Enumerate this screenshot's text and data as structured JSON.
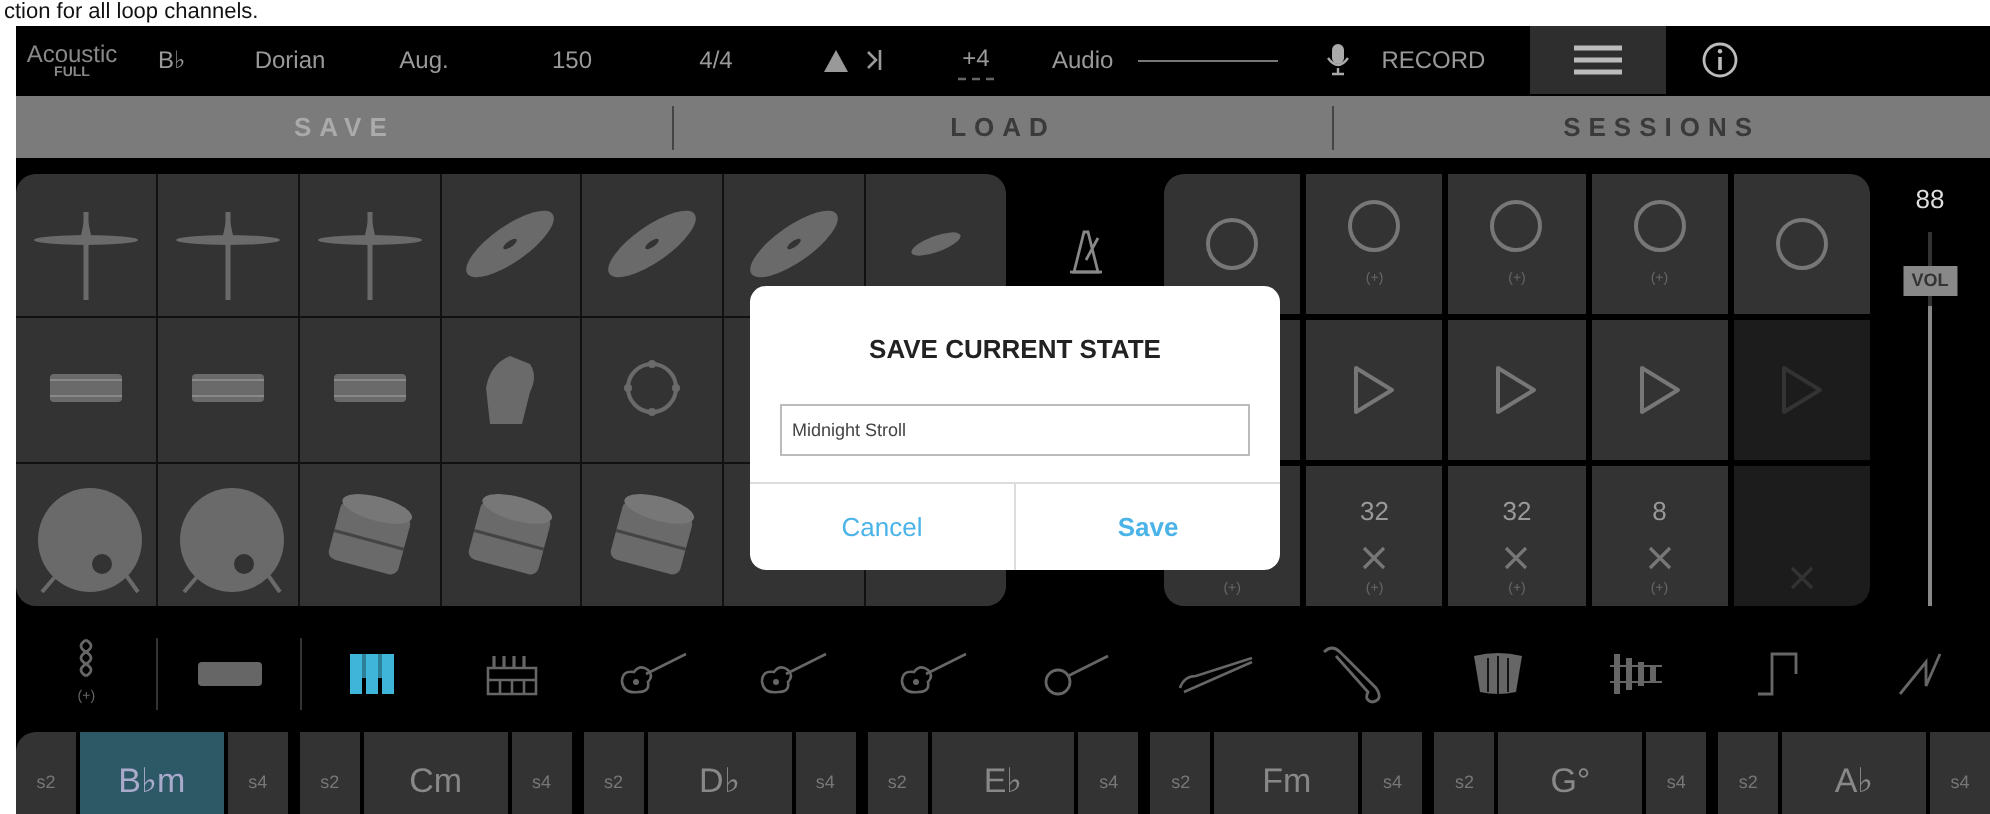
{
  "page_caption": "ction for all loop channels.",
  "top_bar": {
    "logo": "Acoustic",
    "logo_sub": "FULL",
    "key": "B♭",
    "mode": "Dorian",
    "chord_type": "Aug.",
    "tempo": "150",
    "time_signature": "4/4",
    "transpose": "+4",
    "audio": "Audio",
    "record": "RECORD"
  },
  "tabs": [
    {
      "label": "SAVE",
      "selected": true
    },
    {
      "label": "LOAD",
      "selected": false
    },
    {
      "label": "SESSIONS",
      "selected": false
    }
  ],
  "drum_pads": [
    [
      {
        "kind": "cymbal-stand"
      },
      {
        "kind": "cymbal-stand"
      },
      {
        "kind": "cymbal-stand"
      },
      {
        "kind": "cymbal"
      },
      {
        "kind": "cymbal"
      },
      {
        "kind": "cymbal"
      },
      {
        "kind": "splash"
      }
    ],
    [
      {
        "kind": "snare"
      },
      {
        "kind": "snare"
      },
      {
        "kind": "snare"
      },
      {
        "kind": "clap"
      },
      {
        "kind": "tambourine"
      }
    ],
    [
      {
        "kind": "kick"
      },
      {
        "kind": "kick"
      },
      {
        "kind": "tom"
      },
      {
        "kind": "tom"
      },
      {
        "kind": "tom"
      }
    ]
  ],
  "loops": [
    {
      "clear_hint": "(+)",
      "enabled": true,
      "covered": true
    },
    {
      "record_hint": "(+)",
      "length": "32",
      "clear_hint": "(+)",
      "enabled": true,
      "covered": false
    },
    {
      "record_hint": "(+)",
      "length": "32",
      "clear_hint": "(+)",
      "enabled": true,
      "covered": false
    },
    {
      "record_hint": "(+)",
      "length": "8",
      "clear_hint": "(+)",
      "enabled": true,
      "covered": false
    },
    {
      "enabled": false,
      "covered": false
    }
  ],
  "volume": {
    "value": "88",
    "label": "VOL",
    "level": 0.8
  },
  "dialog": {
    "title": "SAVE CURRENT STATE",
    "value": "Midnight Stroll",
    "buttons": [
      "Cancel",
      "Save"
    ]
  },
  "instruments": [
    {
      "kind": "chain",
      "hint": "(+)",
      "selected": false
    },
    {
      "kind": "bar",
      "selected": false
    },
    {
      "kind": "keys",
      "selected": true
    },
    {
      "kind": "organ",
      "selected": false
    },
    {
      "kind": "guitar",
      "selected": false
    },
    {
      "kind": "guitar",
      "selected": false
    },
    {
      "kind": "guitar",
      "selected": false
    },
    {
      "kind": "banjo",
      "selected": false
    },
    {
      "kind": "horn",
      "selected": false
    },
    {
      "kind": "saxophone",
      "selected": false
    },
    {
      "kind": "accordion",
      "selected": false
    },
    {
      "kind": "xylophone",
      "selected": false
    },
    {
      "kind": "square-wave",
      "selected": false
    },
    {
      "kind": "sawtooth-wave",
      "selected": false
    }
  ],
  "chords": [
    {
      "left": "s2",
      "chord": "B♭m",
      "right": "s4",
      "selected": true
    },
    {
      "left": "s2",
      "chord": "Cm",
      "right": "s4",
      "selected": false
    },
    {
      "left": "s2",
      "chord": "D♭",
      "right": "s4",
      "selected": false
    },
    {
      "left": "s2",
      "chord": "E♭",
      "right": "s4",
      "selected": false
    },
    {
      "left": "s2",
      "chord": "Fm",
      "right": "s4",
      "selected": false
    },
    {
      "left": "s2",
      "chord": "G°",
      "right": "s4",
      "selected": false
    },
    {
      "left": "s2",
      "chord": "A♭",
      "right": "s4",
      "selected": false
    }
  ]
}
